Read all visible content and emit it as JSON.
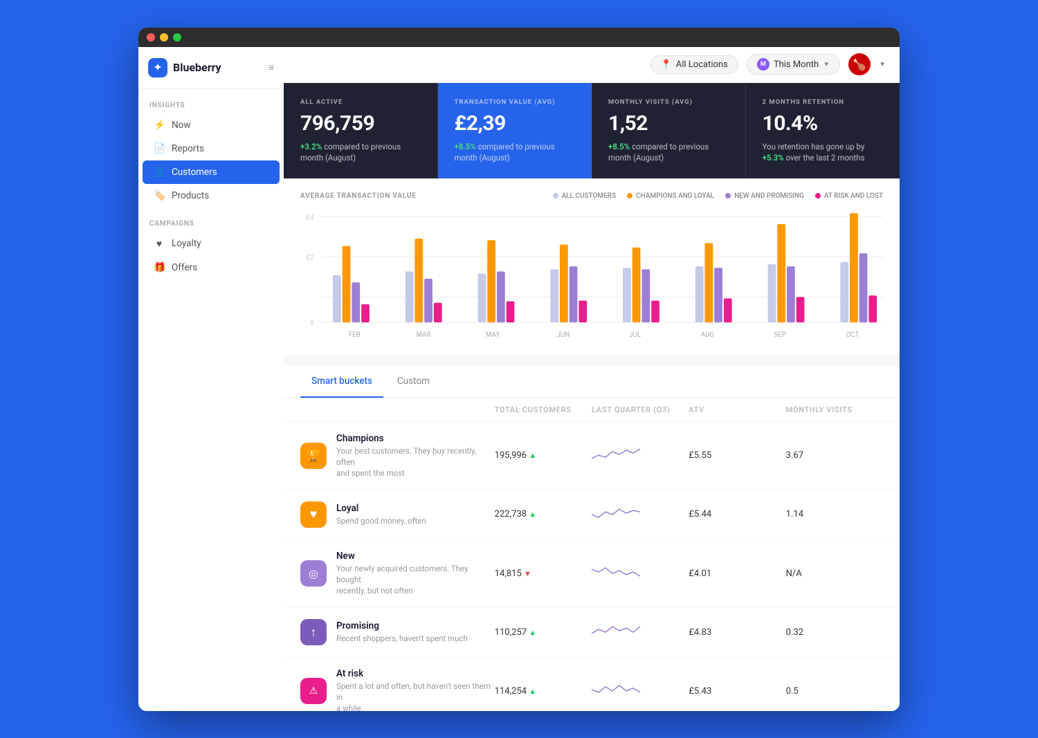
{
  "app": {
    "name": "Blueberry",
    "logo_char": "✦"
  },
  "titlebar": {
    "dots": [
      "red",
      "yellow",
      "green"
    ]
  },
  "sidebar": {
    "insights_label": "INSIGHTS",
    "campaigns_label": "CAMPAIGNS",
    "items_insights": [
      {
        "id": "now",
        "label": "Now",
        "icon": "⚡"
      },
      {
        "id": "reports",
        "label": "Reports",
        "icon": "📄"
      },
      {
        "id": "customers",
        "label": "Customers",
        "icon": "👤",
        "active": true
      },
      {
        "id": "products",
        "label": "Products",
        "icon": "🏷️"
      }
    ],
    "items_campaigns": [
      {
        "id": "loyalty",
        "label": "Loyalty",
        "icon": "♥"
      },
      {
        "id": "offers",
        "label": "Offers",
        "icon": "🎁"
      }
    ]
  },
  "topbar": {
    "location_filter": "All Locations",
    "time_filter": "This Month",
    "location_icon": "📍",
    "month_initial": "M"
  },
  "stats": [
    {
      "label": "ALL ACTIVE",
      "value": "796,759",
      "change_pct": "+3.2%",
      "change_text": "compared to previous month (August)",
      "highlight": false
    },
    {
      "label": "TRANSACTION VALUE (AVG)",
      "value": "£2,39",
      "change_pct": "+8.5%",
      "change_text": "compared to previous month (August)",
      "highlight": true
    },
    {
      "label": "MONTHLY VISITS (AVG)",
      "value": "1,52",
      "change_pct": "+8.5%",
      "change_text": "compared to previous month (August)",
      "highlight": false
    },
    {
      "label": "2 MONTHS RETENTION",
      "value": "10.4%",
      "change_text": "You retention has gone up by",
      "change_pct2": "+5.3%",
      "change_text2": "over the last 2 months",
      "highlight": false
    }
  ],
  "chart": {
    "title": "AVERAGE TRANSACTION VALUE",
    "legend": [
      {
        "label": "ALL CUSTOMERS",
        "color": "#c5cae9"
      },
      {
        "label": "CHAMPIONS AND LOYAL",
        "color": "#ff9800"
      },
      {
        "label": "NEW AND PROMISING",
        "color": "#9c7fd4"
      },
      {
        "label": "AT RISK AND LOST",
        "color": "#e91e8c"
      }
    ],
    "months": [
      "FEB",
      "MAR",
      "MAY",
      "JUN",
      "JUL",
      "AUG",
      "SEP",
      "OCT"
    ],
    "y_labels": [
      "£4",
      "£2",
      "0"
    ]
  },
  "tabs": [
    {
      "id": "smart-buckets",
      "label": "Smart buckets",
      "active": true
    },
    {
      "id": "custom",
      "label": "Custom",
      "active": false
    }
  ],
  "table": {
    "headers": [
      "",
      "Total customers",
      "Last quarter (Q3)",
      "ATV",
      "Monthly visits"
    ],
    "rows": [
      {
        "id": "champions",
        "icon_bg": "#ff9800",
        "icon": "🏆",
        "name": "Champions",
        "desc": "Your best customers. They buy recently, often and spent the most",
        "total": "195,996",
        "change": "up",
        "atv": "£5.55",
        "monthly_visits": "3.67",
        "trend_color": "#9c7fd4"
      },
      {
        "id": "loyal",
        "icon_bg": "#ff9800",
        "icon": "♥",
        "name": "Loyal",
        "desc": "Spend good money, often",
        "total": "222,738",
        "change": "up",
        "atv": "£5.44",
        "monthly_visits": "1.14",
        "trend_color": "#9c7fd4"
      },
      {
        "id": "new",
        "icon_bg": "#9c7fd4",
        "icon": "◎",
        "name": "New",
        "desc": "Your newly acquired customers. They bought recently, but not often",
        "total": "14,815",
        "change": "down",
        "atv": "£4.01",
        "monthly_visits": "N/A",
        "trend_color": "#9c7fd4"
      },
      {
        "id": "promising",
        "icon_bg": "#7c5cba",
        "icon": "↑",
        "name": "Promising",
        "desc": "Recent shoppers, haven't spent much",
        "total": "110,257",
        "change": "up",
        "atv": "£4.83",
        "monthly_visits": "0.32",
        "trend_color": "#9c7fd4"
      },
      {
        "id": "at-risk",
        "icon_bg": "#e91e8c",
        "icon": "⚠",
        "name": "At risk",
        "desc": "Spent a lot and often, but haven't seen them in a while",
        "total": "114,254",
        "change": "up",
        "atv": "£5.43",
        "monthly_visits": "0.5",
        "trend_color": "#9c7fd4"
      }
    ]
  }
}
